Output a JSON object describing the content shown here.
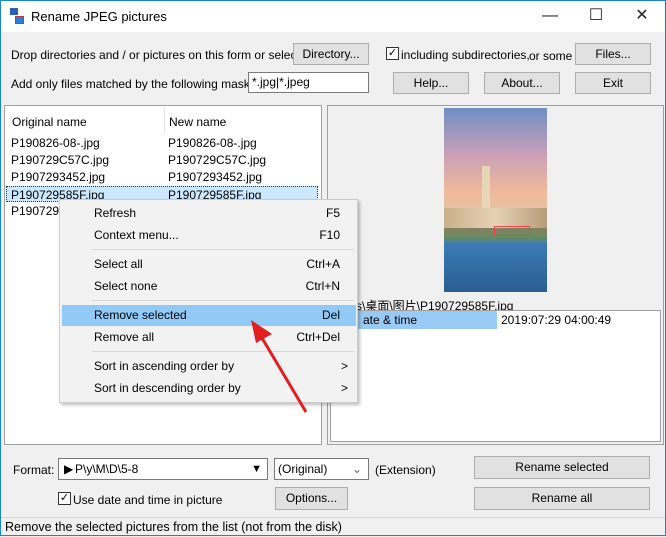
{
  "window": {
    "title": "Rename JPEG pictures",
    "minimize": "—",
    "maximize": "☐",
    "close": "✕"
  },
  "top": {
    "drop_label": "Drop directories and / or pictures on this form or select a",
    "directory_button": "Directory...",
    "subdirs_checked": true,
    "subdirs_label": "including subdirectories,",
    "or_some": "or some",
    "files_button": "Files...",
    "mask_label": "Add only files matched by the following mask(s) :",
    "mask_value": "*.jpg|*.jpeg",
    "help_button": "Help...",
    "about_button": "About...",
    "exit_button": "Exit"
  },
  "list": {
    "columns": [
      "Original name",
      "New name"
    ],
    "rows": [
      {
        "original": "P190826-08-.jpg",
        "new": "P190826-08-.jpg"
      },
      {
        "original": "P190729C57C.jpg",
        "new": "P190729C57C.jpg"
      },
      {
        "original": "P1907293452.jpg",
        "new": "P1907293452.jpg"
      },
      {
        "original": "P190729585F.jpg",
        "new": "P190729585F.jpg",
        "selected": true
      },
      {
        "original": "P190729a",
        "new": ""
      }
    ]
  },
  "context_menu": {
    "items": [
      {
        "label": "Refresh",
        "shortcut": "F5"
      },
      {
        "label": "Context menu...",
        "shortcut": "F10"
      },
      {
        "label": "Select all",
        "shortcut": "Ctrl+A"
      },
      {
        "label": "Select none",
        "shortcut": "Ctrl+N"
      },
      {
        "label": "Remove selected",
        "shortcut": "Del",
        "highlighted": true
      },
      {
        "label": "Remove all",
        "shortcut": "Ctrl+Del"
      },
      {
        "label": "Sort in ascending order by",
        "shortcut": ">"
      },
      {
        "label": "Sort in descending order by",
        "shortcut": ">"
      }
    ]
  },
  "preview": {
    "path": "s\\桌面\\图片\\P190729585F.jpg",
    "details": [
      {
        "key": "ate & time",
        "value": "2019:07:29 04:00:49"
      }
    ]
  },
  "bottom": {
    "format_label": "Format:",
    "format_value": "P\\y\\M\\D\\5-8",
    "extension_value": "(Original)",
    "extension_label": "(Extension)",
    "use_date_checked": true,
    "use_date_label": "Use date and time in picture",
    "options_button": "Options...",
    "rename_selected_button": "Rename selected",
    "rename_all_button": "Rename all"
  },
  "status": "Remove the selected pictures from the list (not from the disk)",
  "colors": {
    "selection": "#cce8ff",
    "menu_highlight": "#91c9f7",
    "arrow": "#e02020",
    "detail_highlight": "#99c9f5"
  }
}
